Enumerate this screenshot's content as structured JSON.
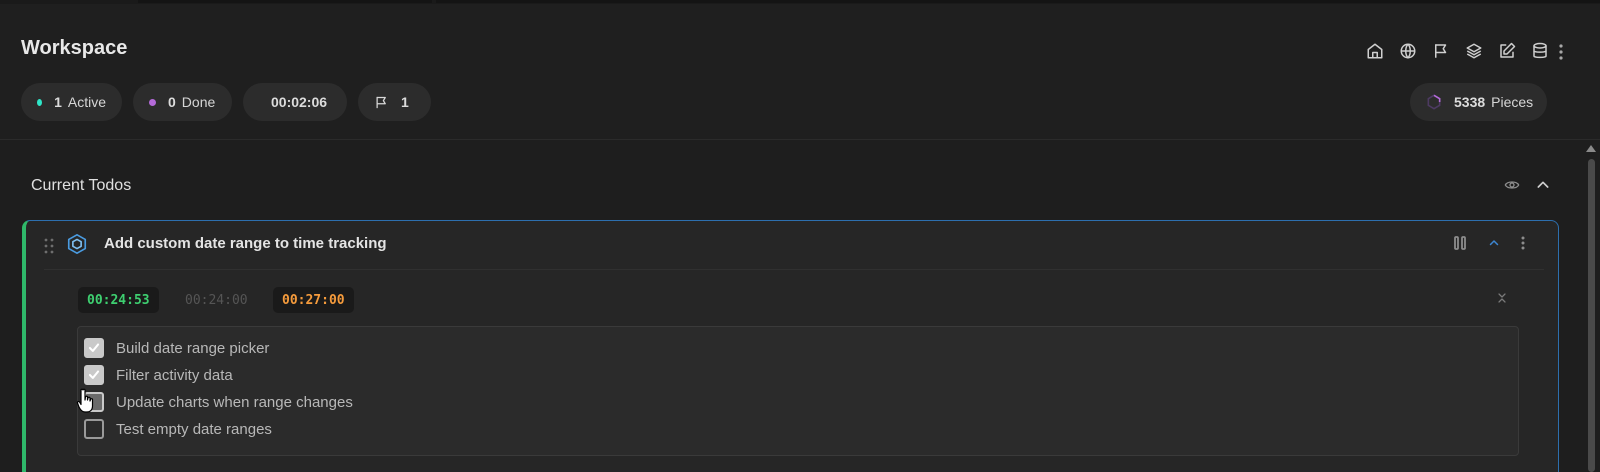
{
  "header": {
    "title": "Workspace",
    "icons": [
      "home-icon",
      "globe-icon",
      "flag-icon",
      "layers-icon",
      "edit-icon",
      "database-icon",
      "more-vertical-icon"
    ],
    "stats": {
      "active": {
        "value": "1",
        "label": "Active",
        "color": "#2ee6c8"
      },
      "done": {
        "value": "0",
        "label": "Done",
        "color": "#b46ad9"
      },
      "time": {
        "value": "00:02:06",
        "color": "#d9b018"
      },
      "flags": {
        "value": "1"
      }
    },
    "pieces": {
      "value": "5338",
      "label": "Pieces"
    }
  },
  "section": {
    "title": "Current Todos"
  },
  "todo": {
    "title": "Add custom date range to time tracking",
    "accent_color": "#2fb86a",
    "border_color": "#2d6fae",
    "timers": {
      "elapsed": "00:24:53",
      "estimate": "00:24:00",
      "limit": "00:27:00"
    },
    "subtasks": [
      {
        "label": "Build date range picker",
        "checked": true
      },
      {
        "label": "Filter activity data",
        "checked": true
      },
      {
        "label": "Update charts when range changes",
        "checked": false
      },
      {
        "label": "Test empty date ranges",
        "checked": false
      }
    ]
  }
}
